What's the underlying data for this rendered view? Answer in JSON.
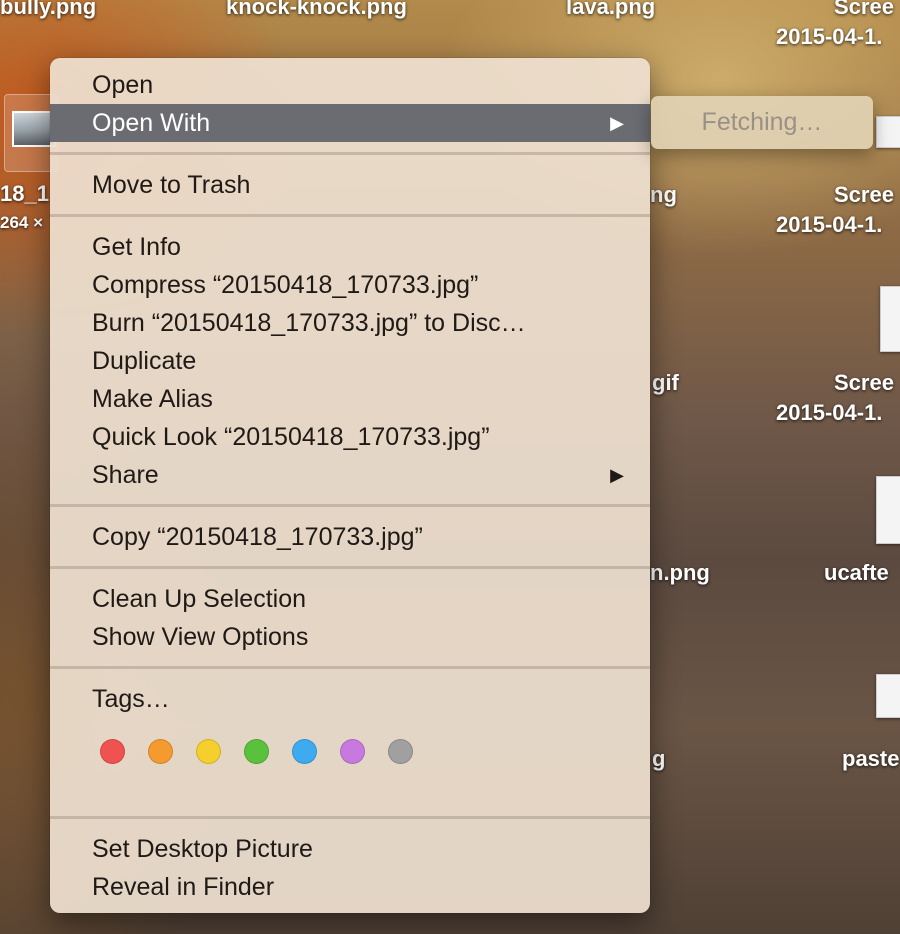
{
  "desktop": {
    "labels": [
      {
        "text": "bully.png"
      },
      {
        "text": "knock-knock.png"
      },
      {
        "text": "lava.png"
      },
      {
        "text": "Scree"
      },
      {
        "text": "2015-04-1."
      },
      {
        "text": "18_1"
      },
      {
        "text": "264 ×"
      },
      {
        "text": "ng"
      },
      {
        "text": "Scree"
      },
      {
        "text": "2015-04-1."
      },
      {
        "text": "gif"
      },
      {
        "text": "Scree"
      },
      {
        "text": "2015-04-1."
      },
      {
        "text": "n.png"
      },
      {
        "text": "ucafte"
      },
      {
        "text": "g"
      },
      {
        "text": "paste"
      }
    ]
  },
  "context_menu": {
    "items": [
      {
        "label": "Open"
      },
      {
        "label": "Open With",
        "arrow": "▶"
      },
      {
        "label": "Move to Trash"
      },
      {
        "label": "Get Info"
      },
      {
        "label": "Compress “20150418_170733.jpg”"
      },
      {
        "label": "Burn “20150418_170733.jpg” to Disc…"
      },
      {
        "label": "Duplicate"
      },
      {
        "label": "Make Alias"
      },
      {
        "label": "Quick Look “20150418_170733.jpg”"
      },
      {
        "label": "Share",
        "arrow": "▶"
      },
      {
        "label": "Copy “20150418_170733.jpg”"
      },
      {
        "label": "Clean Up Selection"
      },
      {
        "label": "Show View Options"
      },
      {
        "label": "Tags…"
      },
      {
        "label": "Set Desktop Picture"
      },
      {
        "label": "Reveal in Finder"
      }
    ],
    "tag_colors": [
      {
        "name": "red",
        "color": "#f0524f"
      },
      {
        "name": "orange",
        "color": "#f59a2f"
      },
      {
        "name": "yellow",
        "color": "#f5cf2c"
      },
      {
        "name": "green",
        "color": "#5ac13d"
      },
      {
        "name": "blue",
        "color": "#3eaaf0"
      },
      {
        "name": "purple",
        "color": "#c879e0"
      },
      {
        "name": "gray",
        "color": "#a0a0a0"
      }
    ]
  },
  "submenu": {
    "status": "Fetching…"
  }
}
